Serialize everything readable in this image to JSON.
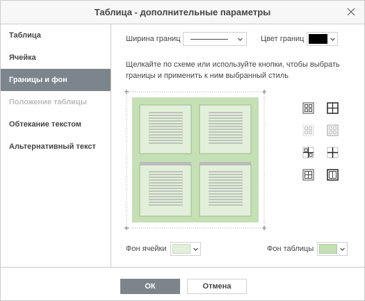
{
  "dialog": {
    "title": "Таблица - дополнительные параметры"
  },
  "sidebar": {
    "items": [
      {
        "label": "Таблица"
      },
      {
        "label": "Ячейка"
      },
      {
        "label": "Границы и фон"
      },
      {
        "label": "Положение таблицы"
      },
      {
        "label": "Обтекание текстом"
      },
      {
        "label": "Альтернативный текст"
      }
    ],
    "active_index": 2,
    "disabled_index": 3
  },
  "borders": {
    "width_label": "Ширина границ",
    "color_label": "Цвет границ",
    "color_value": "#000000",
    "help_text": "Щелкайте по схеме или используйте кнопки, чтобы выбрать границы и применить к ним выбранный стиль"
  },
  "background": {
    "cell_label": "Фон ячейки",
    "cell_color": "#e2efda",
    "table_label": "Фон таблицы",
    "table_color": "#c5e0b4"
  },
  "buttons": {
    "ok": "ОК",
    "cancel": "Отмена"
  },
  "icons": {
    "close": "close-icon",
    "dropdown": "chevron-down-icon"
  },
  "colors": {
    "active_bg": "#7d858c",
    "table_green": "#c5e0b4",
    "cell_green": "#e2efda"
  }
}
